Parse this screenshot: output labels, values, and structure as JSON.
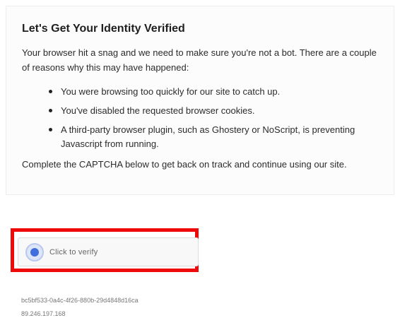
{
  "notice": {
    "title": "Let's Get Your Identity Verified",
    "intro": "Your browser hit a snag and we need to make sure you're not a bot. There are a couple of reasons why this may have happened:",
    "reasons": [
      "You were browsing too quickly for our site to catch up.",
      "You've disabled the requested browser cookies.",
      "A third-party browser plugin, such as Ghostery or NoScript, is preventing Javascript from running."
    ],
    "outro": "Complete the CAPTCHA below to get back on track and continue using our site."
  },
  "captcha": {
    "label": "Click to verify",
    "highlight_color": "#ee0a0a",
    "accent_color": "#3f6fdc",
    "icon": "verify-circle-icon"
  },
  "footer": {
    "reference_id": "bc5bf533-0a4c-4f26-880b-29d4848d16ca",
    "ip_address": "89.246.197.168"
  }
}
